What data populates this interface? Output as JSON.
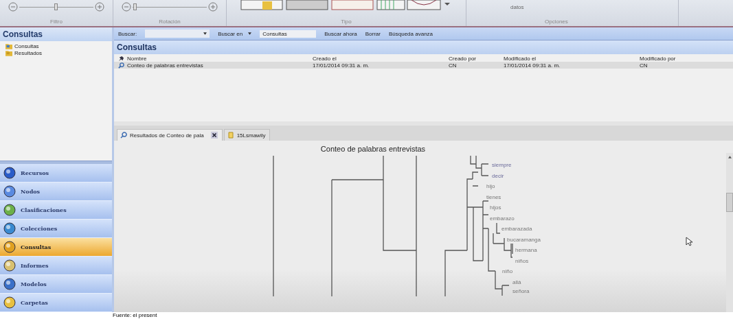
{
  "ribbon": {
    "groups": [
      {
        "label": "Filtro",
        "kind": "slider",
        "level": 0.5
      },
      {
        "label": "Rotación",
        "kind": "slider",
        "level": 0.04
      },
      {
        "label": "Tipo",
        "kind": "gallery"
      },
      {
        "label": "Opciones",
        "kind": "option",
        "text": "datos"
      }
    ]
  },
  "left_panel": {
    "title": "Consultas",
    "tree": [
      {
        "label": "Consultas",
        "selected": false
      },
      {
        "label": "Resultados",
        "selected": false
      }
    ],
    "nav": [
      {
        "label": "Recursos",
        "selected": false
      },
      {
        "label": "Nodos",
        "selected": false
      },
      {
        "label": "Clasificaciones",
        "selected": false
      },
      {
        "label": "Colecciones",
        "selected": false
      },
      {
        "label": "Consultas",
        "selected": true
      },
      {
        "label": "Informes",
        "selected": false
      },
      {
        "label": "Modelos",
        "selected": false
      },
      {
        "label": "Carpetas",
        "selected": false
      }
    ]
  },
  "search_bar": {
    "label": "Buscar:",
    "search_in_label": "Buscar en",
    "search_in_value": "Consultas",
    "actions": [
      "Buscar ahora",
      "Borrar",
      "Búsqueda avanza"
    ]
  },
  "list": {
    "title": "Consultas",
    "columns": [
      "Nombre",
      "Creado el",
      "Creado por",
      "Modificado el",
      "Modificado por"
    ],
    "rows": [
      {
        "cells": [
          "Conteo de palabras entrevistas",
          "17/01/2014 09:31 a. m.",
          "CN",
          "17/01/2014 09:31 a. m.",
          "CN"
        ],
        "selected": true
      }
    ]
  },
  "tabs": [
    {
      "label": "Resultados de Conteo de pala",
      "selected": true
    },
    {
      "label": "15Lsmawily",
      "selected": false
    }
  ],
  "dendrogram": {
    "title": "Conteo de palabras entrevistas",
    "leaves": [
      "siempre",
      "decir",
      "hijo",
      "tienes",
      "hijos",
      "embarazo",
      "embarazada",
      "bucaramanga",
      "hermana",
      "niños",
      "niño",
      "allá",
      "señora"
    ]
  },
  "caption": "Fuente: el present"
}
